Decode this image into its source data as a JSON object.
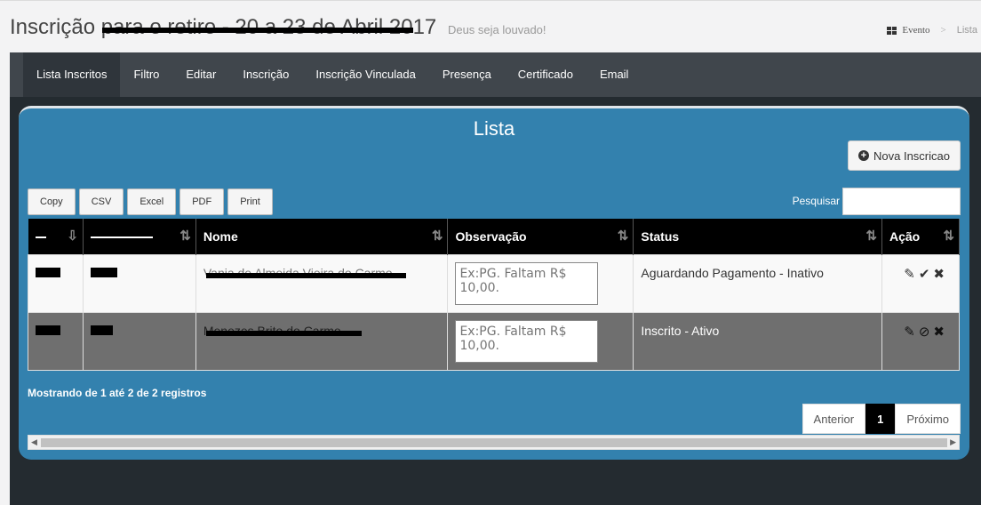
{
  "header": {
    "title": "Inscrição para o retiro - 20 a 23 de Abril 2017",
    "subtitle": "Deus seja louvado!",
    "breadcrumb": [
      "Evento",
      "Lista"
    ]
  },
  "nav": {
    "tabs": [
      "Lista Inscritos",
      "Filtro",
      "Editar",
      "Inscrição",
      "Inscrição Vinculada",
      "Presença",
      "Certificado",
      "Email"
    ],
    "active": "Lista Inscritos"
  },
  "panel": {
    "title": "Lista",
    "new_button": "Nova Inscricao",
    "export_buttons": [
      "Copy",
      "CSV",
      "Excel",
      "PDF",
      "Print"
    ],
    "search_label": "Pesquisar"
  },
  "table": {
    "headers": [
      "",
      "",
      "Nome",
      "Observação",
      "Status",
      "Ação"
    ],
    "rows": [
      {
        "id": "222",
        "code": "",
        "name": "Vania de Almeida Vieira do Carmo",
        "obs_placeholder": "Ex:PG. Faltam R$ 10,00.",
        "status": "Aguardando Pagamento - Inativo",
        "actions": [
          "edit-icon",
          "check-icon",
          "close-icon"
        ]
      },
      {
        "id": "123",
        "code": "",
        "name": "Menezes Brito do Carmo",
        "obs_placeholder": "Ex:PG. Faltam R$ 10,00.",
        "status": "Inscrito - Ativo",
        "actions": [
          "edit-icon",
          "ban-icon",
          "close-icon"
        ]
      }
    ]
  },
  "footer": {
    "info": "Mostrando de 1 até 2 de 2 registros",
    "prev": "Anterior",
    "page": "1",
    "next": "Próximo"
  }
}
